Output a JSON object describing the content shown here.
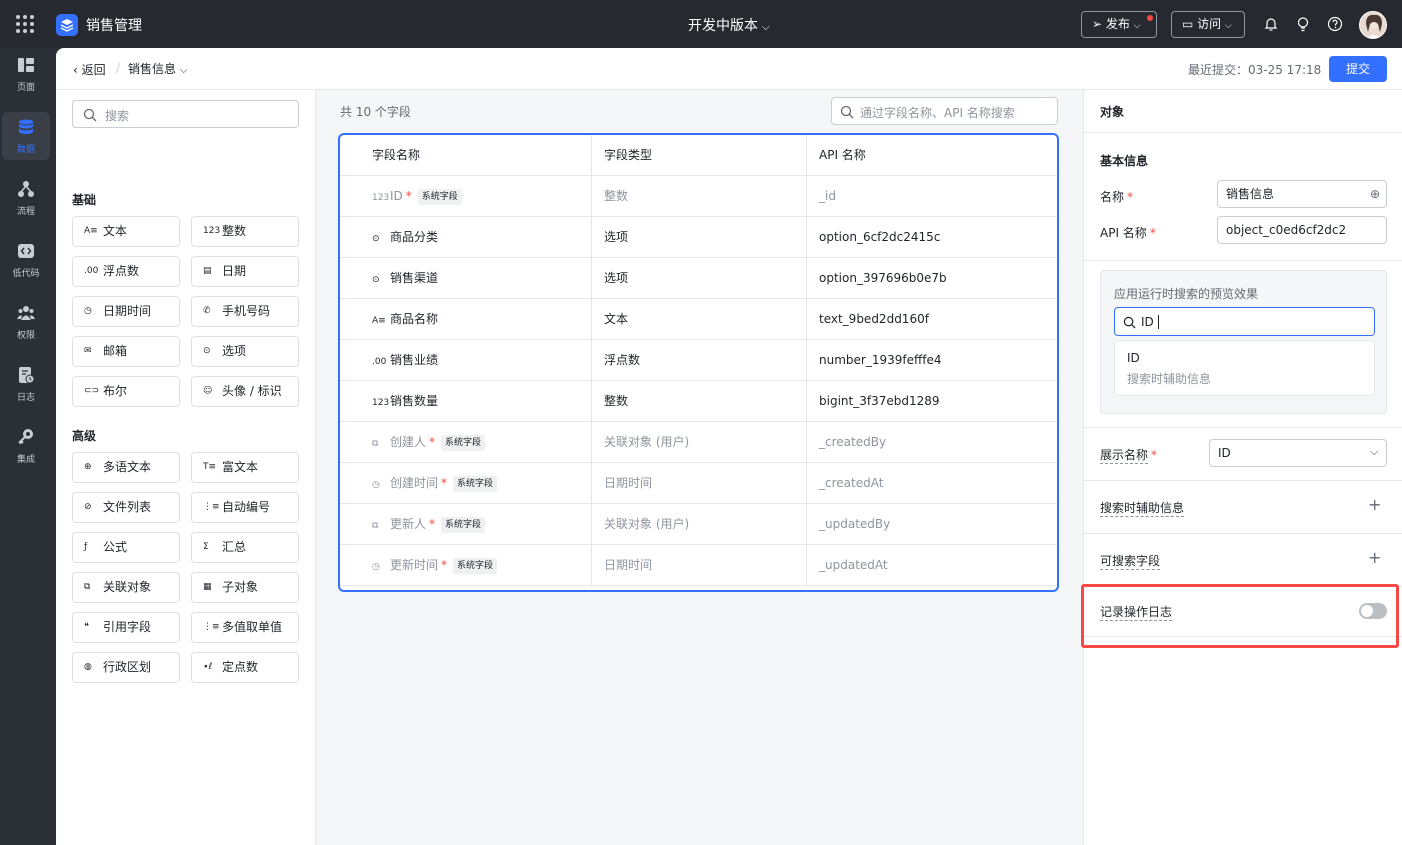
{
  "topbar": {
    "app_name": "销售管理",
    "version": "开发中版本",
    "publish": "发布",
    "visit": "访问"
  },
  "leftnav": [
    {
      "label": "页面",
      "icon": "page-icon"
    },
    {
      "label": "数据",
      "icon": "database-icon",
      "active": true
    },
    {
      "label": "流程",
      "icon": "flow-icon"
    },
    {
      "label": "低代码",
      "icon": "lowcode-icon"
    },
    {
      "label": "权限",
      "icon": "permission-icon"
    },
    {
      "label": "日志",
      "icon": "log-icon"
    },
    {
      "label": "集成",
      "icon": "integration-icon"
    }
  ],
  "subbar": {
    "back": "返回",
    "current": "销售信息",
    "last_submit": "最近提交：03-25 17:18",
    "submit": "提交"
  },
  "palette": {
    "search_placeholder": "搜索",
    "basic_title": "基础",
    "basic": [
      {
        "label": "文本",
        "icon": "text-icon",
        "glyph": "A≡"
      },
      {
        "label": "整数",
        "icon": "integer-icon",
        "glyph": "123"
      },
      {
        "label": "浮点数",
        "icon": "float-icon",
        "glyph": ".00"
      },
      {
        "label": "日期",
        "icon": "date-icon",
        "glyph": "▤"
      },
      {
        "label": "日期时间",
        "icon": "datetime-icon",
        "glyph": "◷"
      },
      {
        "label": "手机号码",
        "icon": "phone-icon",
        "glyph": "✆"
      },
      {
        "label": "邮箱",
        "icon": "email-icon",
        "glyph": "✉"
      },
      {
        "label": "选项",
        "icon": "option-icon",
        "glyph": "⊙"
      },
      {
        "label": "布尔",
        "icon": "boolean-icon",
        "glyph": "⊂⊃"
      },
      {
        "label": "头像 / 标识",
        "icon": "avatar-icon",
        "glyph": "☺"
      }
    ],
    "advanced_title": "高级",
    "advanced": [
      {
        "label": "多语文本",
        "icon": "multilang-icon",
        "glyph": "⊕"
      },
      {
        "label": "富文本",
        "icon": "richtext-icon",
        "glyph": "T≡"
      },
      {
        "label": "文件列表",
        "icon": "file-list-icon",
        "glyph": "⊘"
      },
      {
        "label": "自动编号",
        "icon": "auto-number-icon",
        "glyph": "⋮≡"
      },
      {
        "label": "公式",
        "icon": "formula-icon",
        "glyph": "ƒ"
      },
      {
        "label": "汇总",
        "icon": "sum-icon",
        "glyph": "Σ"
      },
      {
        "label": "关联对象",
        "icon": "lookup-icon",
        "glyph": "⧉"
      },
      {
        "label": "子对象",
        "icon": "sub-object-icon",
        "glyph": "▦"
      },
      {
        "label": "引用字段",
        "icon": "quote-icon",
        "glyph": "❝"
      },
      {
        "label": "多值取单值",
        "icon": "multi-value-icon",
        "glyph": "⋮≡"
      },
      {
        "label": "行政区划",
        "icon": "region-icon",
        "glyph": "◍"
      },
      {
        "label": "定点数",
        "icon": "decimal-icon",
        "glyph": "∙ℓ"
      }
    ]
  },
  "middle": {
    "count": "共 10 个字段",
    "search_placeholder": "通过字段名称、API 名称搜索",
    "headers": [
      "字段名称",
      "字段类型",
      "API 名称"
    ],
    "system_tag": "系统字段",
    "rows": [
      {
        "glyph": "123",
        "name": "ID",
        "required": true,
        "system": true,
        "type": "整数",
        "api": "_id"
      },
      {
        "glyph": "⊙",
        "name": "商品分类",
        "required": false,
        "system": false,
        "type": "选项",
        "api": "option_6cf2dc2415c"
      },
      {
        "glyph": "⊙",
        "name": "销售渠道",
        "required": false,
        "system": false,
        "type": "选项",
        "api": "option_397696b0e7b"
      },
      {
        "glyph": "A≡",
        "name": "商品名称",
        "required": false,
        "system": false,
        "type": "文本",
        "api": "text_9bed2dd160f"
      },
      {
        "glyph": ".00",
        "name": "销售业绩",
        "required": false,
        "system": false,
        "type": "浮点数",
        "api": "number_1939fefffe4"
      },
      {
        "glyph": "123",
        "name": "销售数量",
        "required": false,
        "system": false,
        "type": "整数",
        "api": "bigint_3f37ebd1289"
      },
      {
        "glyph": "⧉",
        "name": "创建人",
        "required": true,
        "system": true,
        "type": "关联对象 (用户)",
        "api": "_createdBy"
      },
      {
        "glyph": "◷",
        "name": "创建时间",
        "required": true,
        "system": true,
        "type": "日期时间",
        "api": "_createdAt"
      },
      {
        "glyph": "⧉",
        "name": "更新人",
        "required": true,
        "system": true,
        "type": "关联对象 (用户)",
        "api": "_updatedBy"
      },
      {
        "glyph": "◷",
        "name": "更新时间",
        "required": true,
        "system": true,
        "type": "日期时间",
        "api": "_updatedAt"
      }
    ]
  },
  "rpanel": {
    "title": "对象",
    "basic_info": "基本信息",
    "name_label": "名称",
    "name_value": "销售信息",
    "api_label": "API 名称",
    "api_value": "object_c0ed6cf2dc2",
    "preview_title": "应用运行时搜索的预览效果",
    "preview_input": "ID",
    "preview_result_main": "ID",
    "preview_result_sub": "搜索时辅助信息",
    "display_label": "展示名称",
    "display_value": "ID",
    "search_aux_label": "搜索时辅助信息",
    "searchable_label": "可搜索字段",
    "log_label": "记录操作日志",
    "log_enabled": false
  }
}
